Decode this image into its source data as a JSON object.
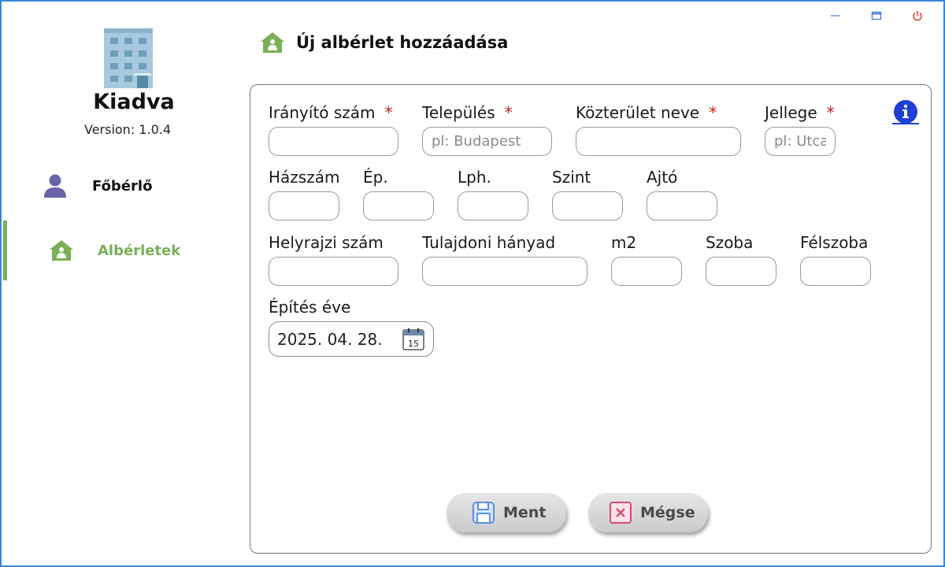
{
  "app": {
    "name": "Kiadva",
    "version": "Version: 1.0.4"
  },
  "window_controls": {
    "minimize_glyph": "—",
    "maximize_glyph": "▭",
    "close_glyph": "⏻"
  },
  "sidebar": {
    "items": [
      {
        "label": "Főbérlő",
        "icon": "user-icon",
        "active": false
      },
      {
        "label": "Albérletek",
        "icon": "home-icon",
        "active": true
      }
    ]
  },
  "header": {
    "title": "Új albérlet hozzáadása",
    "icon": "home-icon"
  },
  "form": {
    "required_mark": "*",
    "fields": {
      "zip": {
        "label": "Irányító szám",
        "value": "",
        "placeholder": ""
      },
      "city": {
        "label": "Település",
        "value": "",
        "placeholder": "pl: Budapest"
      },
      "street_name": {
        "label": "Közterület neve",
        "value": "",
        "placeholder": ""
      },
      "street_type": {
        "label": "Jellege",
        "value": "",
        "placeholder": "pl: Utca"
      },
      "house_number": {
        "label": "Házszám",
        "value": "",
        "placeholder": ""
      },
      "building": {
        "label": "Ép.",
        "value": "",
        "placeholder": ""
      },
      "staircase": {
        "label": "Lph.",
        "value": "",
        "placeholder": ""
      },
      "floor": {
        "label": "Szint",
        "value": "",
        "placeholder": ""
      },
      "door": {
        "label": "Ajtó",
        "value": "",
        "placeholder": ""
      },
      "lot_number": {
        "label": "Helyrajzi szám",
        "value": "",
        "placeholder": ""
      },
      "ownership_share": {
        "label": "Tulajdoni hányad",
        "value": "",
        "placeholder": ""
      },
      "area": {
        "label": "m2",
        "value": "",
        "placeholder": ""
      },
      "rooms": {
        "label": "Szoba",
        "value": "",
        "placeholder": ""
      },
      "half_rooms": {
        "label": "Félszoba",
        "value": "",
        "placeholder": ""
      },
      "build_year": {
        "label": "Építés éve",
        "value": "2025. 04. 28.",
        "calendar_day": "15"
      }
    }
  },
  "actions": {
    "save_label": "Ment",
    "cancel_label": "Mégse"
  },
  "colors": {
    "accent": "#7ab055",
    "required": "#d11a1a",
    "info": "#1f3fd6",
    "frame": "#3a86d4"
  }
}
